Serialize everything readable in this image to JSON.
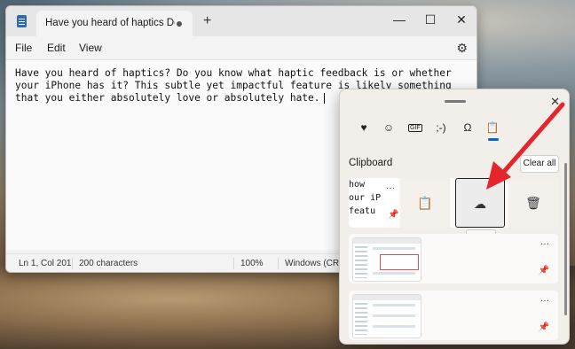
{
  "notepad": {
    "tab_title": "Have you heard of haptics Do you k",
    "new_tab_symbol": "+",
    "controls": {
      "minimize": "—",
      "maximize": "☐",
      "close": "✕"
    },
    "menu": [
      "File",
      "Edit",
      "View"
    ],
    "editor_text": "Have you heard of haptics? Do you know what haptic feedback is or whether your iPhone has it? This subtle yet impactful feature is likely something that you either absolutely love or absolutely hate.",
    "status": {
      "position": "Ln 1, Col 201",
      "chars": "200 characters",
      "zoom": "100%",
      "encoding": "Windows (CRLF)"
    }
  },
  "clipboard_panel": {
    "close": "✕",
    "categories": [
      "emoji-icon",
      "smiley-icon",
      "gif-icon",
      "kaomoji-icon",
      "symbols-icon",
      "clipboard-history-icon"
    ],
    "kaomoji": ";-)",
    "gif": "GIF",
    "section_title": "Clipboard",
    "clear_all": "Clear all",
    "item1_lines": [
      "how",
      "our iP",
      "featu"
    ],
    "more": "···",
    "tooltip": "Sync",
    "accent_color": "#0067c0",
    "arrow_color": "#e5242b"
  }
}
